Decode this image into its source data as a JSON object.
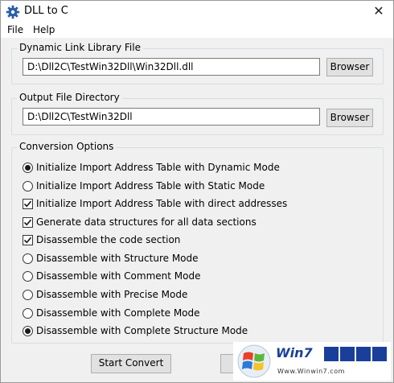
{
  "window": {
    "title": "DLL to C",
    "close_glyph": "✕"
  },
  "menu": {
    "items": [
      "File",
      "Help"
    ]
  },
  "dll_group": {
    "legend": "Dynamic Link Library File",
    "path": "D:\\Dll2C\\TestWin32Dll\\Win32Dll.dll",
    "browse_label": "Browser"
  },
  "output_group": {
    "legend": "Output File Directory",
    "path": "D:\\Dll2C\\TestWin32Dll",
    "browse_label": "Browser"
  },
  "options_group": {
    "legend": "Conversion Options",
    "options": [
      {
        "label": "Initialize Import Address Table with Dynamic Mode",
        "control": "radio",
        "checked": true
      },
      {
        "label": "Initialize Import Address Table with Static Mode",
        "control": "radio",
        "checked": false
      },
      {
        "label": "Initialize Import Address Table with direct addresses",
        "control": "checkbox",
        "checked": true
      },
      {
        "label": "Generate data structures for all data sections",
        "control": "checkbox",
        "checked": true
      },
      {
        "label": "Disassemble the code section",
        "control": "checkbox",
        "checked": true
      },
      {
        "label": "Disassemble with Structure Mode",
        "control": "radio",
        "checked": false
      },
      {
        "label": "Disassemble with Comment Mode",
        "control": "radio",
        "checked": false
      },
      {
        "label": "Disassemble with Precise Mode",
        "control": "radio",
        "checked": false
      },
      {
        "label": "Disassemble with Complete Mode",
        "control": "radio",
        "checked": false
      },
      {
        "label": "Disassemble with Complete Structure Mode",
        "control": "radio",
        "checked": true
      }
    ]
  },
  "actions": {
    "start_label": "Start Convert"
  },
  "watermark": {
    "text": "Win7",
    "sub": "Www.Winwin7.com"
  },
  "colors": {
    "accent": "#1a3f9a",
    "window_bg": "#f0f0f0"
  }
}
